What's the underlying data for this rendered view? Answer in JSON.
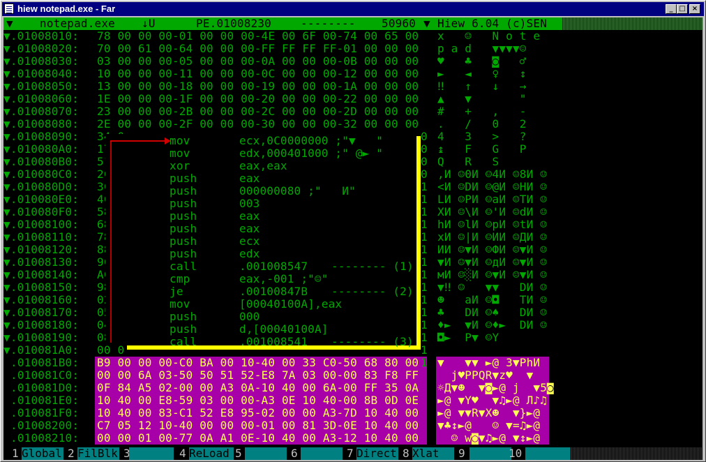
{
  "window": {
    "title": "hiew notepad.exe - Far"
  },
  "colors": {
    "screen_bg": "#000000",
    "text_green": "#00a800",
    "header_bg": "#00a800",
    "highlight_bg": "#a800a8",
    "highlight_text": "#ffff55",
    "frame": "#ffff00",
    "arrow": "#d00000",
    "fkey_label_bg": "#008080"
  },
  "header": {
    "filename": "notepad.exe",
    "mode": "↓U",
    "offset": "PE.01008230",
    "dashes": "--------",
    "size": "50960",
    "marker": "▼",
    "version": "Hiew 6.04 (c)SEN"
  },
  "hex_rows": [
    {
      "addr": "▼.01008010:",
      "hex": "78 00 00 00-01 00 00 00-4E 00 6F 00-74 00 65 00",
      "ascii": "x   ☺   N o t e"
    },
    {
      "addr": "▼.01008020:",
      "hex": "70 00 61 00-64 00 00 00-FF FF FF FF-01 00 00 00",
      "ascii": "p a d   ▼▼▼▼☺"
    },
    {
      "addr": "▼.01008030:",
      "hex": "03 00 00 00-05 00 00 00-0A 00 00 00-0B 00 00 00",
      "ascii": "♥   ♣   ◙   ♂"
    },
    {
      "addr": "▼.01008040:",
      "hex": "10 00 00 00-11 00 00 00-0C 00 00 00-12 00 00 00",
      "ascii": "►   ◄   ♀   ↕"
    },
    {
      "addr": "▼.01008050:",
      "hex": "13 00 00 00-18 00 00 00-19 00 00 00-1A 00 00 00",
      "ascii": "‼   ↑   ↓   →"
    },
    {
      "addr": "▼.01008060:",
      "hex": "1E 00 00 00-1F 00 00 00-20 00 00 00-22 00 00 00",
      "ascii": "▲   ▼       \""
    },
    {
      "addr": "▼.01008070:",
      "hex": "23 00 00 00-2B 00 00 00-2C 00 00 00-2D 00 00 00",
      "ascii": "#   +   ,   -"
    },
    {
      "addr": "▼.01008080:",
      "hex": "2E 00 00 00-2F 00 00 00-30 00 00 00-32 00 00 00",
      "ascii": ".   /   0   2"
    },
    {
      "addr": "▼.01008090:",
      "hex": "34 0",
      "ascii": "4   3   >   ?"
    },
    {
      "addr": "▼.010080A0:",
      "hex": "17 0",
      "ascii": "↨   F   G   P"
    },
    {
      "addr": "▼.010080B0:",
      "hex": "51 0",
      "ascii": "Q   R   S"
    },
    {
      "addr": "▼.010080C0:",
      "hex": "2C 8",
      "ascii": ",И ☺0И ☺4И ☺8И ☺"
    },
    {
      "addr": "▼.010080D0:",
      "hex": "3C 8",
      "ascii": "<И ☺DИ ☺@И ☺HИ ☺"
    },
    {
      "addr": "▼.010080E0:",
      "hex": "4C 8",
      "ascii": "LИ ☺PИ ☺aИ ☺TИ ☺"
    },
    {
      "addr": "▼.010080F0:",
      "hex": "58 8",
      "ascii": "XИ ☺\\И ☺'И ☺dИ ☺"
    },
    {
      "addr": "▼.01008100:",
      "hex": "68 8",
      "ascii": "hИ ☺lИ ☺pИ ☺tИ ☺"
    },
    {
      "addr": "▼.01008110:",
      "hex": "78 8",
      "ascii": "xИ ☺|И ☺ИИ ☺ДИ ☺"
    },
    {
      "addr": "▼.01008120:",
      "hex": "88 8",
      "ascii": "ИИ ☺▼И ☺ФИ ☺▼И ☺"
    },
    {
      "addr": "▼.01008130:",
      "hex": "9C 8",
      "ascii": "▼И ☺▼И ☺дИ ☺▼И ☺"
    },
    {
      "addr": "▼.01008140:",
      "hex": "AC 8",
      "ascii": "мИ ☺░И ☺▼И ☺▼И ☺"
    },
    {
      "addr": "▼.01008150:",
      "hex": "98 1",
      "ascii": "▼‼ ☺   ▼▼   DИ ☺"
    },
    {
      "addr": "▼.01008160:",
      "hex": "02 0",
      "ascii": "☻   aИ ☺◘   TИ ☺"
    },
    {
      "addr": "▼.01008170:",
      "hex": "05 0",
      "ascii": "♣   DИ ☺♠   DИ ☺"
    },
    {
      "addr": "▼.01008180:",
      "hex": "04 1",
      "ascii": "♦►  ▼И ☺♦►  DИ ☺"
    },
    {
      "addr": "▼.01008190:",
      "hex": "08 1",
      "ascii": "◘►  P▼ ☺Y"
    },
    {
      "addr": "▼.010081A0:",
      "hex": "00 0",
      "ascii": ""
    }
  ],
  "hex_rows_highlighted": [
    {
      "addr": ".010081B0:",
      "hex": "B9 00 00 00-C0 BA 00 10-40 00 33 C0-50 68 80 00",
      "ascii": "▼   ▼▼ ►@ 3▼PhИ"
    },
    {
      "addr": ".010081C0:",
      "hex": "00 00 6A 03-50 50 51 52-E8 7A 03 00-00 83 F8 FF",
      "ascii": "  j♥PPQR▼z♥  ▼"
    },
    {
      "addr": ".010081D0:",
      "hex": "0F 84 A5 02-00 00 A3 0A-10 40 00 6A-00 FF 35 0A",
      "ascii": "☼Д▼☻  ▼◙►@ j  ▼5◙"
    },
    {
      "addr": ".010081E0:",
      "hex": "10 40 00 E8-59 03 00 00-A3 0E 10 40-00 8B 0D 0E",
      "ascii": "►@ ▼Y♥  ▼♫►@ Л♪♫"
    },
    {
      "addr": ".010081F0:",
      "hex": "10 40 00 83-C1 52 E8 95-02 00 00 A3-7D 10 40 00",
      "ascii": "►@ ▼▼R▼Х☻  ▼}►@"
    },
    {
      "addr": ".01008200:",
      "hex": "C7 05 12 10-40 00 00 00-01 00 81 3D-0E 10 40 00",
      "ascii": "▼♣↕►@   ☺ ▼=♫►@"
    },
    {
      "addr": ".01008210:",
      "hex": "00 00 01 00-77 0A A1 0E-10 40 00 A3-12 10 40 00",
      "ascii": "  ☺ w◙▼♫►@ ▼↕►@"
    }
  ],
  "disasm": [
    {
      "mnemonic": "mov",
      "operand": "ecx,0C0000000 ;\"▼   \"",
      "ref": ""
    },
    {
      "mnemonic": "mov",
      "operand": "edx,000401000 ;\" @► \"",
      "ref": ""
    },
    {
      "mnemonic": "xor",
      "operand": "eax,eax",
      "ref": ""
    },
    {
      "mnemonic": "push",
      "operand": "eax",
      "ref": ""
    },
    {
      "mnemonic": "push",
      "operand": "000000080 ;\"   И\"",
      "ref": ""
    },
    {
      "mnemonic": "push",
      "operand": "003",
      "ref": ""
    },
    {
      "mnemonic": "push",
      "operand": "eax",
      "ref": ""
    },
    {
      "mnemonic": "push",
      "operand": "eax",
      "ref": ""
    },
    {
      "mnemonic": "push",
      "operand": "ecx",
      "ref": ""
    },
    {
      "mnemonic": "push",
      "operand": "edx",
      "ref": ""
    },
    {
      "mnemonic": "call",
      "operand": ".001008547",
      "ref": "-------- (1)"
    },
    {
      "mnemonic": "cmp",
      "operand": "eax,-001 ;\"☺\"",
      "ref": ""
    },
    {
      "mnemonic": "je",
      "operand": ".00100847B",
      "ref": "-------- (2)"
    },
    {
      "mnemonic": "mov",
      "operand": "[00040100A],eax",
      "ref": ""
    },
    {
      "mnemonic": "push",
      "operand": "000",
      "ref": ""
    },
    {
      "mnemonic": "push",
      "operand": "d,[00040100A]",
      "ref": ""
    },
    {
      "mnemonic": "call",
      "operand": ".001008541",
      "ref": "-------- (3)"
    }
  ],
  "right_edge_digits": [
    "0",
    "0",
    "0",
    "0",
    "1",
    "1",
    "1",
    "1",
    "1",
    "1",
    "1",
    "1",
    "1",
    "1",
    "1",
    "1",
    "1",
    "1",
    "1"
  ],
  "fkeys": [
    {
      "num": "1",
      "label": "Global"
    },
    {
      "num": "2",
      "label": "FilBlk"
    },
    {
      "num": "3",
      "label": ""
    },
    {
      "num": "4",
      "label": "ReLoad"
    },
    {
      "num": "5",
      "label": ""
    },
    {
      "num": "6",
      "label": ""
    },
    {
      "num": "7",
      "label": "Direct"
    },
    {
      "num": "8",
      "label": "Xlat"
    },
    {
      "num": "9",
      "label": ""
    },
    {
      "num": "10",
      "label": ""
    }
  ]
}
